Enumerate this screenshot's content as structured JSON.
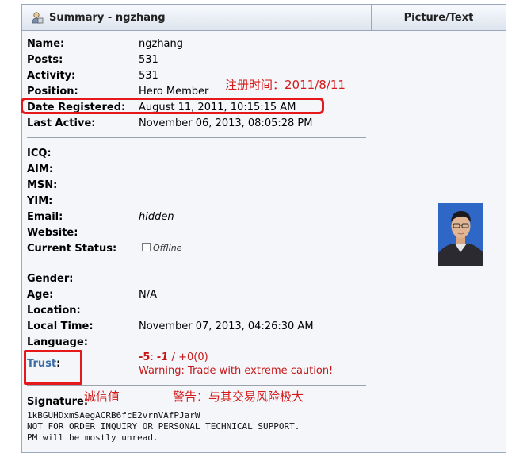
{
  "header": {
    "title": "Summary - ngzhang",
    "right_title": "Picture/Text",
    "icon": "user-icon"
  },
  "profile": {
    "name_label": "Name:",
    "name": "ngzhang",
    "posts_label": "Posts:",
    "posts": "531",
    "activity_label": "Activity:",
    "activity": "531",
    "position_label": "Position:",
    "position": "Hero Member",
    "date_registered_label": "Date Registered:",
    "date_registered": "August 11, 2011, 10:15:15 AM",
    "last_active_label": "Last Active:",
    "last_active": "November 06, 2013, 08:05:28 PM"
  },
  "contact": {
    "icq_label": "ICQ:",
    "aim_label": "AIM:",
    "msn_label": "MSN:",
    "yim_label": "YIM:",
    "email_label": "Email:",
    "email": "hidden",
    "website_label": "Website:",
    "status_label": "Current Status:",
    "status": "Offline"
  },
  "personal": {
    "gender_label": "Gender:",
    "age_label": "Age:",
    "age": "N/A",
    "location_label": "Location:",
    "local_time_label": "Local Time:",
    "local_time": "November 07, 2013, 04:26:30 AM",
    "language_label": "Language:"
  },
  "trust": {
    "label": "Trust",
    "colon": ":",
    "score": "-5",
    "sep": ": ",
    "neg": "-1",
    "slash": " / ",
    "pos": "+0(0)",
    "warning": "Warning: Trade with extreme caution!"
  },
  "signature": {
    "label": "Signature:",
    "line1": "1kBGUHDxmSAegACRB6fcE2vrnVAfPJarW",
    "line2": "NOT FOR ORDER INQUIRY OR PERSONAL TECHNICAL SUPPORT.",
    "line3": "PM will be mostly unread."
  },
  "annotations": {
    "registered": "注册时间：2011/8/11",
    "trust": "诚信值",
    "warning": "警告：与其交易风险极大",
    "color": "#e5191b"
  }
}
